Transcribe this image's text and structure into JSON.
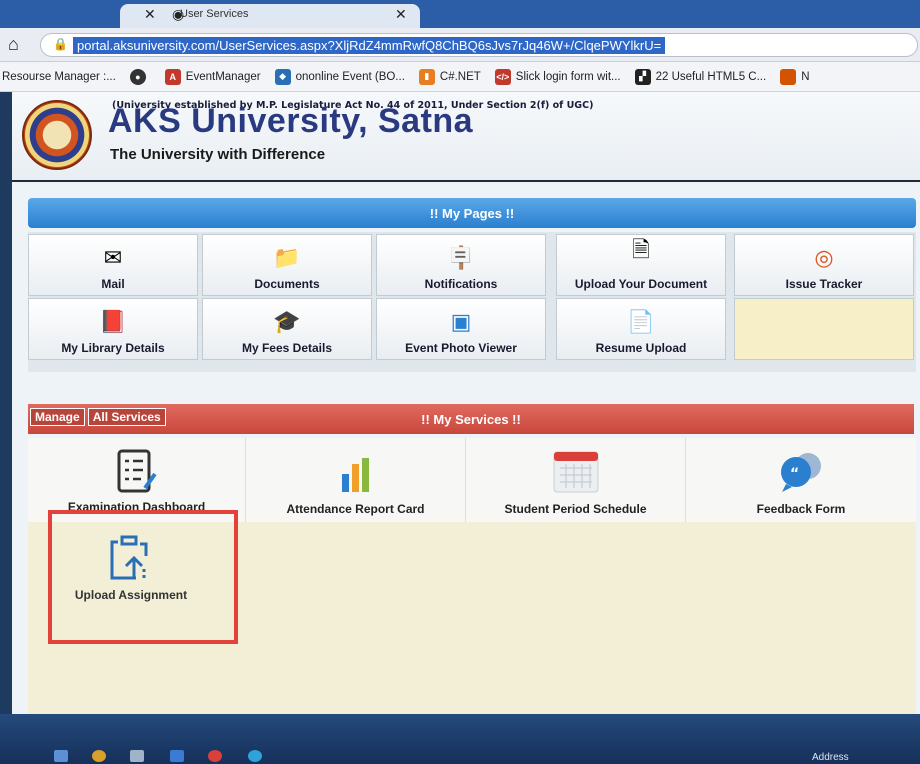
{
  "browser": {
    "tab_title": "User Services",
    "url": "portal.aksuniversity.com/UserServices.aspx?XljRdZ4mmRwfQ8ChBQ6sJvs7rJq46W+/ClqePWYlkrU=",
    "bookmarks": [
      {
        "label": "Resourse Manager :...",
        "color": "#f2f4f7"
      },
      {
        "label": "",
        "color": "#333333"
      },
      {
        "label": "EventManager",
        "color": "#c0392b"
      },
      {
        "label": "ononline Event (BO...",
        "color": "#2a6fb5"
      },
      {
        "label": "C#.NET",
        "color": "#e67e22"
      },
      {
        "label": "Slick login form wit...",
        "color": "#c0392b"
      },
      {
        "label": "22 Useful HTML5 C...",
        "color": "#222222"
      },
      {
        "label": "N",
        "color": "#d35400"
      }
    ]
  },
  "header": {
    "established": "(University established by M.P. Legislature Act No. 44 of 2011, Under Section 2(f) of UGC)",
    "title": "AKS University, Satna",
    "tagline": "The University with Difference"
  },
  "my_pages": {
    "heading": "!! My Pages !!",
    "tiles": [
      {
        "label": "Mail",
        "icon": "mail-icon"
      },
      {
        "label": "Documents",
        "icon": "folder-icon"
      },
      {
        "label": "Notifications",
        "icon": "notice-board-icon"
      },
      {
        "label": "Upload Your Document",
        "icon": "upload-document-icon"
      },
      {
        "label": "Issue Tracker",
        "icon": "issue-tracker-icon"
      },
      {
        "label": "My Library Details",
        "icon": "library-book-icon"
      },
      {
        "label": "My Fees Details",
        "icon": "fees-icon"
      },
      {
        "label": "Event Photo Viewer",
        "icon": "photo-viewer-icon"
      },
      {
        "label": "Resume Upload",
        "icon": "resume-icon"
      }
    ]
  },
  "my_services": {
    "heading": "!! My Services !!",
    "tab_manage": "Manage",
    "tab_all": "All Services",
    "items": [
      {
        "label": "Examination Dashboard",
        "icon": "checklist-icon"
      },
      {
        "label": "Attendance Report Card",
        "icon": "bar-chart-icon"
      },
      {
        "label": "Student Period Schedule",
        "icon": "calendar-icon"
      },
      {
        "label": "Feedback Form",
        "icon": "speech-bubble-icon"
      },
      {
        "label": "Upload Assignment",
        "icon": "upload-assignment-icon"
      }
    ]
  },
  "taskbar": {
    "address_label": "Address"
  },
  "colors": {
    "pages_bar": "#2a7fcf",
    "services_bar": "#c9473d",
    "highlight_box": "#e3423a"
  }
}
